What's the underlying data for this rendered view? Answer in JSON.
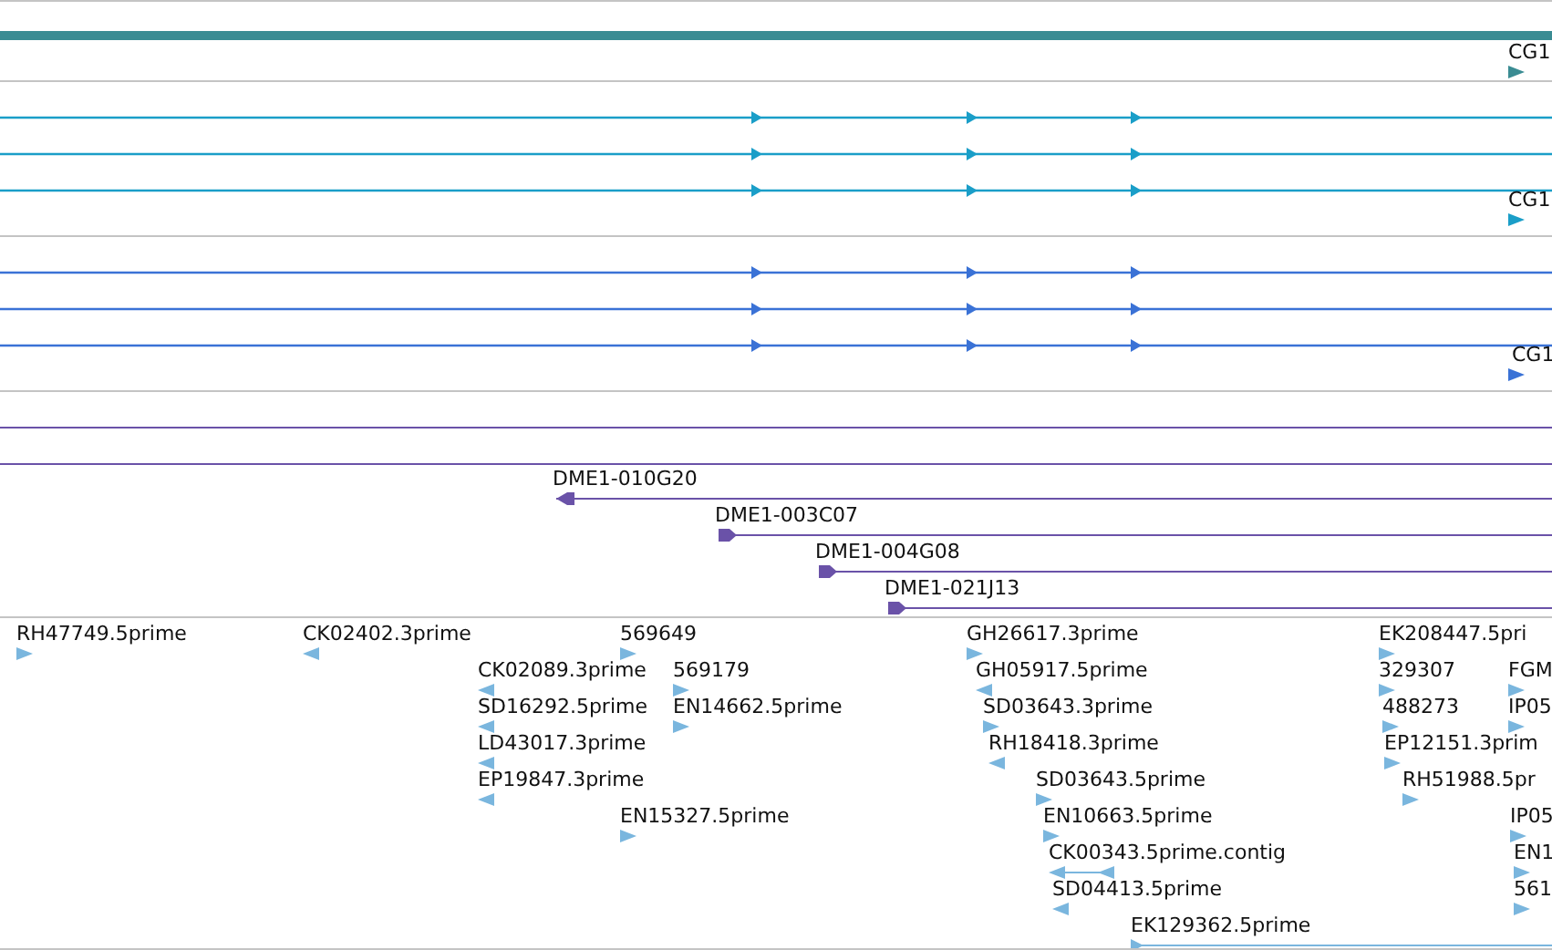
{
  "tracks": [
    {
      "kind": "summary",
      "color": "#3a8c93",
      "label": "CG1"
    },
    {
      "kind": "transcripts",
      "color": "#1a9ec8",
      "label": "CG1"
    },
    {
      "kind": "transcripts",
      "color": "#3a72d6",
      "label": "CG1"
    },
    {
      "kind": "clones",
      "color": "#6a52a8",
      "items": [
        {
          "label": "DME1-010G20",
          "reverse": true
        },
        {
          "label": "DME1-003C07",
          "reverse": false
        },
        {
          "label": "DME1-004G08",
          "reverse": false
        },
        {
          "label": "DME1-021J13",
          "reverse": false
        }
      ]
    },
    {
      "kind": "ests",
      "color": "#7ab6de",
      "items": [
        {
          "label": "RH47749.5prime",
          "reverse": false,
          "kind": "mark"
        },
        {
          "label": "CK02402.3prime",
          "reverse": true,
          "kind": "mark"
        },
        {
          "label": "569649",
          "reverse": false,
          "kind": "mark"
        },
        {
          "label": "GH26617.3prime",
          "reverse": false,
          "kind": "mark"
        },
        {
          "label": "EK208447.5pri",
          "reverse": false,
          "kind": "mark"
        },
        {
          "label": "CK02089.3prime",
          "reverse": true,
          "kind": "mark"
        },
        {
          "label": "569179",
          "reverse": false,
          "kind": "mark"
        },
        {
          "label": "GH05917.5prime",
          "reverse": true,
          "kind": "mark"
        },
        {
          "label": "329307",
          "reverse": false,
          "kind": "mark"
        },
        {
          "label": "FGM",
          "reverse": false,
          "kind": "mark"
        },
        {
          "label": "SD16292.5prime",
          "reverse": true,
          "kind": "mark"
        },
        {
          "label": "EN14662.5prime",
          "reverse": false,
          "kind": "mark"
        },
        {
          "label": "SD03643.3prime",
          "reverse": false,
          "kind": "mark"
        },
        {
          "label": "488273",
          "reverse": false,
          "kind": "mark"
        },
        {
          "label": "IP05",
          "reverse": false,
          "kind": "mark"
        },
        {
          "label": "LD43017.3prime",
          "reverse": true,
          "kind": "mark"
        },
        {
          "label": "RH18418.3prime",
          "reverse": true,
          "kind": "mark"
        },
        {
          "label": "EP12151.3prim",
          "reverse": false,
          "kind": "mark"
        },
        {
          "label": "EP19847.3prime",
          "reverse": true,
          "kind": "mark"
        },
        {
          "label": "SD03643.5prime",
          "reverse": false,
          "kind": "mark"
        },
        {
          "label": "RH51988.5pr",
          "reverse": false,
          "kind": "mark"
        },
        {
          "label": "EN15327.5prime",
          "reverse": false,
          "kind": "mark"
        },
        {
          "label": "EN10663.5prime",
          "reverse": false,
          "kind": "mark"
        },
        {
          "label": "IP05",
          "reverse": false,
          "kind": "mark"
        },
        {
          "label": "CK00343.5prime.contig",
          "reverse": true,
          "kind": "pair"
        },
        {
          "label": "EN1",
          "reverse": false,
          "kind": "mark"
        },
        {
          "label": "SD04413.5prime",
          "reverse": true,
          "kind": "mark"
        },
        {
          "label": "561",
          "reverse": false,
          "kind": "mark"
        },
        {
          "label": "EK129362.5prime",
          "reverse": false,
          "kind": "span"
        }
      ]
    }
  ]
}
